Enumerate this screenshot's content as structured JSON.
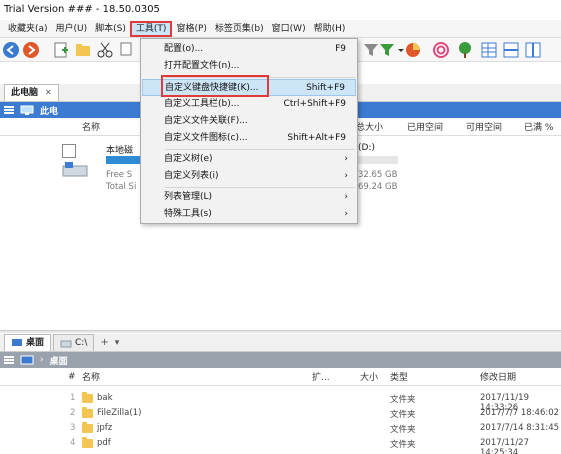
{
  "title": "Trial Version ### - 18.50.0305",
  "menu": [
    "收藏夹(a)",
    "用户(U)",
    "脚本(S)",
    "工具(T)",
    "窗格(P)",
    "标签页集(b)",
    "窗口(W)",
    "帮助(H)"
  ],
  "tools_menu": {
    "items": [
      {
        "label": "配置(o)...",
        "shortcut": "F9"
      },
      {
        "label": "打开配置文件(n)...",
        "shortcut": ""
      },
      {
        "label": "自定义键盘快捷键(K)...",
        "shortcut": "Shift+F9"
      },
      {
        "label": "自定义工具栏(b)...",
        "shortcut": "Ctrl+Shift+F9"
      },
      {
        "label": "自定义文件关联(F)...",
        "shortcut": ""
      },
      {
        "label": "自定义文件图标(c)...",
        "shortcut": "Shift+Alt+F9"
      },
      {
        "label": "自定义树(e)",
        "shortcut": "›"
      },
      {
        "label": "自定义列表(i)",
        "shortcut": "›"
      },
      {
        "label": "列表管理(L)",
        "shortcut": "›"
      },
      {
        "label": "特殊工具(s)",
        "shortcut": "›"
      }
    ]
  },
  "top_pane": {
    "tab": "此电脑",
    "tab_close": "✕",
    "crumb": "此电",
    "columns": {
      "name": "名称",
      "total": "总大小",
      "used": "已用空间",
      "free": "可用空间",
      "pct": "已满 %"
    },
    "drive": {
      "name": "本地磁",
      "free_line": "Free S",
      "total_line": "Total Si",
      "label": "(D:)",
      "free": "32.65 GB",
      "total": "69.24 GB",
      "used_fraction": 0.53
    }
  },
  "bottom_pane": {
    "tabs": [
      "桌面",
      "C:\\"
    ],
    "add": "+",
    "chevron": "▾",
    "crumb": "桌面",
    "columns": {
      "num": "#",
      "name": "名称",
      "ext": "扩...",
      "size": "大小",
      "type": "类型",
      "date": "修改日期"
    },
    "rows": [
      {
        "num": "1",
        "name": "bak",
        "type": "文件夹",
        "date": "2017/11/19 14:33:26"
      },
      {
        "num": "2",
        "name": "FileZilla(1)",
        "type": "文件夹",
        "date": "2017/7/7 18:46:02"
      },
      {
        "num": "3",
        "name": "jpfz",
        "type": "文件夹",
        "date": "2017/7/14 8:31:45"
      },
      {
        "num": "4",
        "name": "pdf",
        "type": "文件夹",
        "date": "2017/11/27 14:25:34"
      }
    ]
  }
}
